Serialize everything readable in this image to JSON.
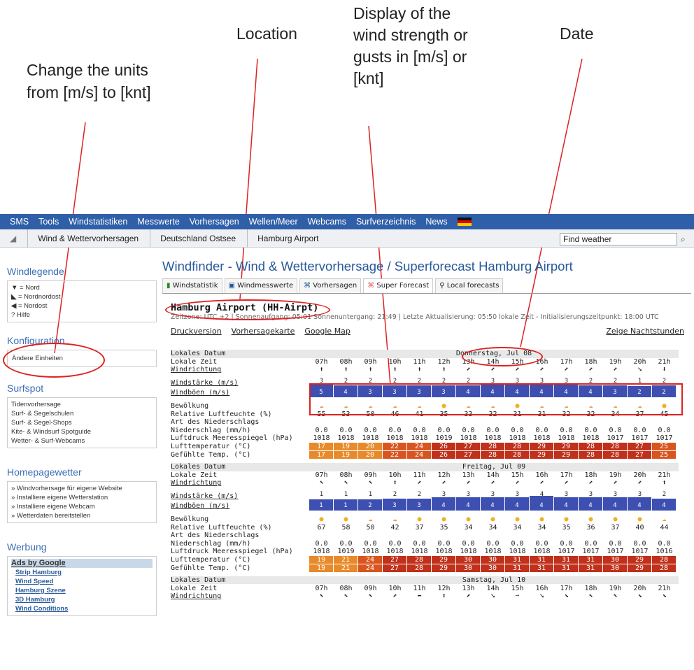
{
  "annotations": {
    "units": "Change the units\nfrom [m/s] to [knt]",
    "location": "Location",
    "strength": "Display of the\nwind strength or\ngusts in [m/s] or\n[knt]",
    "date": "Date"
  },
  "nav": [
    "SMS",
    "Tools",
    "Windstatistiken",
    "Messwerte",
    "Vorhersagen",
    "Wellen/Meer",
    "Webcams",
    "Surfverzeichnis",
    "News"
  ],
  "breadcrumb": [
    "Wind & Wettervorhersagen",
    "Deutschland Ostsee",
    "Hamburg Airport"
  ],
  "search": {
    "placeholder": "Find weather"
  },
  "sidebar": {
    "legend_title": "Windlegende",
    "legend": [
      "= Nord",
      "= Nordnordost",
      "= Nordost",
      "Hilfe"
    ],
    "config_title": "Konfiguration",
    "config_link": "Ändere Einheiten",
    "surfspot_title": "Surfspot",
    "surfspot": [
      "Tidenvorhersage",
      "Surf- & Segelschulen",
      "Surf- & Segel-Shops",
      "Kite- & Windsurf Spotguide",
      "Wetter- & Surf-Webcams"
    ],
    "homepage_title": "Homepagewetter",
    "homepage": [
      "» Windvorhersage für eigene Website",
      "» Installiere eigene Wetterstation",
      "» Installiere eigene Webcam",
      "» Wetterdaten bereitstellen"
    ],
    "ads_title": "Werbung",
    "ads_head": "Ads by Google",
    "ads": [
      "Strip Hamburg",
      "Wind Speed",
      "Hamburg Szene",
      "3D Hamburg",
      "Wind Conditions"
    ]
  },
  "main": {
    "title": "Windfinder - Wind & Wettervorhersage / Superforecast Hamburg Airport",
    "tabs": [
      "Windstatistik",
      "Windmesswerte",
      "Vorhersagen",
      "Super Forecast",
      "Local forecasts"
    ],
    "location": "Hamburg Airport (HH-Airpt)",
    "info": "Zeitzone: UTC +2 | Sonnenaufgang: 05:01 Sonnenuntergang: 21:49 | Letzte Aktualisierung: 05:50 lokale Zeit - Initialisierungszeitpunkt: 18:00 UTC",
    "links": [
      "Druckversion",
      "Vorhersagekarte",
      "Google Map"
    ],
    "night": "Zeige Nachtstunden"
  },
  "labels": {
    "date": "Lokales Datum",
    "time": "Lokale Zeit",
    "dir": "Windrichtung",
    "strength": "Windstärke (m/s)",
    "gusts": "Windböen (m/s)",
    "cloud": "Bewölkung",
    "humid": "Relative Luftfeuchte (%)",
    "precip_type": "Art des Niederschlags",
    "precip": "Niederschlag (mm/h)",
    "pressure": "Luftdruck Meeresspiegel (hPa)",
    "temp": "Lufttemperatur (°C)",
    "feel": "Gefühlte Temp. (°C)"
  },
  "hours": [
    "07h",
    "08h",
    "09h",
    "10h",
    "11h",
    "12h",
    "13h",
    "14h",
    "15h",
    "16h",
    "17h",
    "18h",
    "19h",
    "20h",
    "21h"
  ],
  "days": [
    {
      "date": "Donnerstag, Jul 08",
      "dir": [
        "⬆",
        "⬆",
        "⬆",
        "⬆",
        "⬆",
        "⬆",
        "⬈",
        "⬈",
        "⬈",
        "⬈",
        "⬈",
        "⬈",
        "⬈",
        "➘",
        "⬇"
      ],
      "strength": [
        3,
        2,
        2,
        2,
        2,
        2,
        2,
        3,
        3,
        3,
        3,
        2,
        2,
        1,
        2
      ],
      "gusts": [
        5,
        4,
        3,
        3,
        3,
        3,
        4,
        4,
        4,
        4,
        4,
        4,
        3,
        2,
        2
      ],
      "cloud": [
        "c",
        "c",
        "c",
        "c",
        "c",
        "s",
        "c",
        "c",
        "s",
        "c",
        "c",
        "c",
        "c",
        "c",
        "s"
      ],
      "humid": [
        55,
        53,
        50,
        46,
        41,
        35,
        33,
        32,
        31,
        31,
        32,
        32,
        34,
        37,
        45
      ],
      "precip": [
        "0.0",
        "0.0",
        "0.0",
        "0.0",
        "0.0",
        "0.0",
        "0.0",
        "0.0",
        "0.0",
        "0.0",
        "0.0",
        "0.0",
        "0.0",
        "0.0",
        "0.0"
      ],
      "pressure": [
        1018,
        1018,
        1018,
        1018,
        1018,
        1019,
        1018,
        1018,
        1018,
        1018,
        1018,
        1018,
        1017,
        1017,
        1017
      ],
      "temp": [
        17,
        19,
        20,
        22,
        24,
        26,
        27,
        28,
        28,
        29,
        29,
        28,
        28,
        27,
        25
      ],
      "feel": [
        17,
        19,
        20,
        22,
        24,
        26,
        27,
        28,
        28,
        29,
        29,
        28,
        28,
        27,
        25
      ]
    },
    {
      "date": "Freitag, Jul 09",
      "dir": [
        "⬉",
        "⬉",
        "⬉",
        "⬆",
        "⬈",
        "⬈",
        "⬈",
        "⬈",
        "⬈",
        "⬈",
        "⬈",
        "⬈",
        "⬈",
        "⬈",
        "⬆"
      ],
      "strength": [
        1,
        1,
        1,
        2,
        2,
        3,
        3,
        3,
        3,
        4,
        3,
        3,
        3,
        3,
        2
      ],
      "gusts": [
        1,
        1,
        2,
        3,
        3,
        4,
        4,
        4,
        4,
        4,
        4,
        4,
        4,
        4,
        4
      ],
      "cloud": [
        "s",
        "s",
        "c",
        "c",
        "s",
        "s",
        "s",
        "s",
        "s",
        "s",
        "s",
        "s",
        "s",
        "s",
        "c"
      ],
      "humid": [
        67,
        58,
        50,
        42,
        37,
        35,
        34,
        34,
        34,
        34,
        35,
        36,
        37,
        40,
        44
      ],
      "precip": [
        "0.0",
        "0.0",
        "0.0",
        "0.0",
        "0.0",
        "0.0",
        "0.0",
        "0.0",
        "0.0",
        "0.0",
        "0.0",
        "0.0",
        "0.0",
        "0.0",
        "0.0"
      ],
      "pressure": [
        1018,
        1019,
        1018,
        1018,
        1018,
        1018,
        1018,
        1018,
        1018,
        1018,
        1017,
        1017,
        1017,
        1017,
        1016
      ],
      "temp": [
        19,
        21,
        24,
        27,
        28,
        29,
        30,
        30,
        31,
        31,
        31,
        31,
        30,
        29,
        28
      ],
      "feel": [
        19,
        21,
        24,
        27,
        28,
        29,
        30,
        30,
        31,
        31,
        31,
        31,
        30,
        29,
        28
      ]
    },
    {
      "date": "Samstag, Jul 10",
      "dir": [
        "⬉",
        "⬉",
        "⬉",
        "⬈",
        "⬅",
        "⬆",
        "⬈",
        "➘",
        "➙",
        "➘",
        "⬊",
        "⬉",
        "⬉",
        "⬊",
        "⬊"
      ]
    }
  ]
}
